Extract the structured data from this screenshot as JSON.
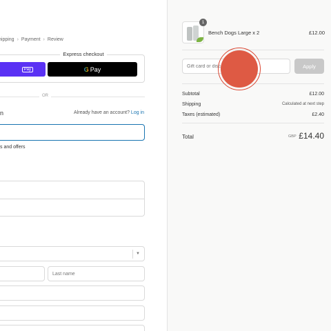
{
  "breadcrumb": {
    "items": [
      "hipping",
      "Payment",
      "Review"
    ],
    "separator": "›"
  },
  "express": {
    "title": "Express checkout",
    "shop_pay_label": "Pay",
    "gpay_g": "G",
    "gpay_label": "Pay"
  },
  "divider": {
    "or_label": "OR"
  },
  "contact": {
    "heading": "n",
    "account_prompt": "Already have an account?",
    "login_link": "Log in",
    "email_value": "",
    "newsletter_label": "s and offers"
  },
  "delivery": {
    "last_name_placeholder": "Last name",
    "caret": "▼"
  },
  "order": {
    "item_quantity_badge": "1",
    "item_name": "Bench Dogs Large x 2",
    "item_price": "£12.00"
  },
  "discount": {
    "placeholder": "Gift card or discount code",
    "apply_label": "Apply"
  },
  "summary": {
    "subtotal_label": "Subtotal",
    "subtotal_value": "£12.00",
    "shipping_label": "Shipping",
    "shipping_value": "Calculated at next step",
    "taxes_label": "Taxes (estimated)",
    "taxes_value": "£2.40",
    "total_label": "Total",
    "currency": "GBP",
    "total_value": "£14.40"
  },
  "colors": {
    "link": "#1773b0",
    "shop_pay": "#5a31f4",
    "gpay": "#000000",
    "apply_disabled": "#c8c8c8",
    "click_marker": "#de5a44"
  },
  "icons": [
    "product-thumbnail",
    "chevron-down-icon",
    "google-g-icon",
    "click-marker"
  ]
}
